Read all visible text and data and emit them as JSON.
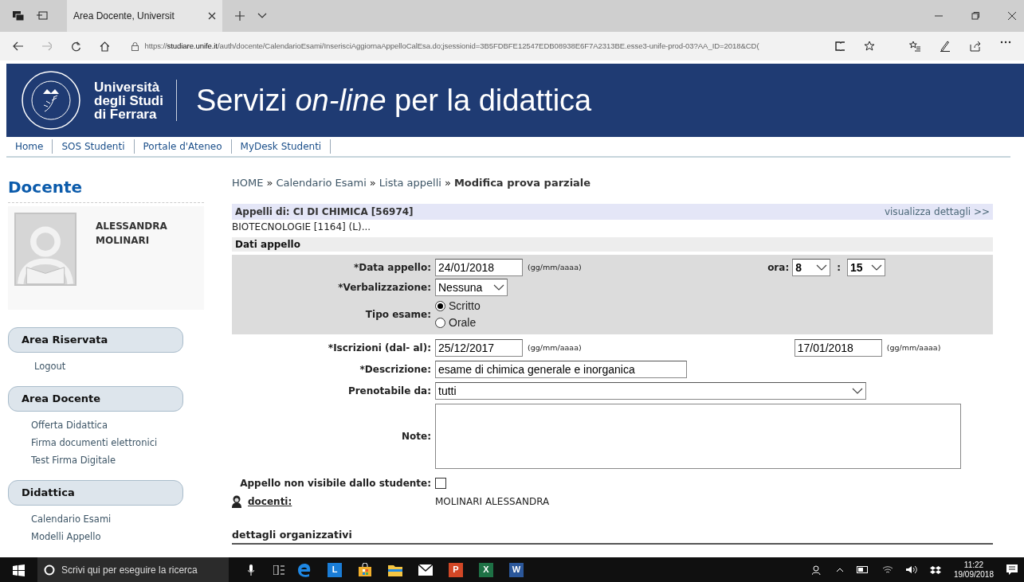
{
  "browser": {
    "tab_title": "Area Docente, Universit",
    "url": "https://**studiare.unife.it**/auth/docente/CalendarioEsami/InserisciAggiornaAppelloCalEsa.do;jsessionid=3B5FDBFE12547EDB08938E6F7A2313BE.esse3-unife-prod-03?AA_ID=2018&CD("
  },
  "header": {
    "logo_lines": [
      "Università",
      "degli Studi",
      "di Ferrara"
    ],
    "title": "Servizi *on-line* per la didattica"
  },
  "nav": [
    "Home",
    "SOS Studenti",
    "Portale d'Ateneo",
    "MyDesk Studenti"
  ],
  "sidebar": {
    "heading": "Docente",
    "user_name": "ALESSANDRA MOLINARI",
    "sections": [
      {
        "title": "Area Riservata",
        "links": [
          "Logout"
        ]
      },
      {
        "title": "Area Docente",
        "links": [
          "Offerta Didattica",
          "Firma documenti elettronici",
          "Test Firma Digitale"
        ]
      },
      {
        "title": "Didattica",
        "links": [
          "Calendario Esami",
          "Modelli Appello"
        ]
      }
    ]
  },
  "breadcrumb": [
    {
      "label": "HOME",
      "current": false
    },
    {
      "separator": "»",
      "label": "Calendario Esami",
      "current": false
    },
    {
      "separator": "»",
      "label": "Lista appelli",
      "current": false
    },
    {
      "separator": "»",
      "label": "Modifica prova parziale",
      "current": true
    }
  ],
  "appelli": {
    "title": "Appelli di: CI DI CHIMICA [56974]",
    "details_link": "visualizza dettagli >>",
    "subtitle": "BIOTECNOLOGIE [1164] (L)..."
  },
  "section_title": "Dati appello",
  "form": {
    "data_appello": {
      "label": "*Data appello:",
      "value": "24/01/2018",
      "hint": "(gg/mm/aaaa)"
    },
    "ora": {
      "label": "ora:",
      "hour": "8",
      "separator": ":",
      "minute": "15"
    },
    "verbalizzazione": {
      "label": "*Verbalizzazione:",
      "value": "Nessuna"
    },
    "tipo_esame": {
      "label": "Tipo esame:",
      "options": [
        {
          "label": "Scritto",
          "selected": true
        },
        {
          "label": "Orale",
          "selected": false
        }
      ]
    },
    "iscrizioni": {
      "label": "*Iscrizioni (dal- al):",
      "from": "25/12/2017",
      "from_hint": "(gg/mm/aaaa)",
      "to": "17/01/2018",
      "to_hint": "(gg/mm/aaaa)"
    },
    "descrizione": {
      "label": "*Descrizione:",
      "value": "esame di chimica generale e inorganica"
    },
    "prenotabile": {
      "label": "Prenotabile da:",
      "value": "tutti"
    },
    "note": {
      "label": "Note:"
    },
    "non_visibile": {
      "label": "Appello non visibile dallo studente:",
      "checked": false
    },
    "docenti": {
      "label": "docenti:",
      "value": "MOLINARI ALESSANDRA"
    }
  },
  "section2_title": "dettagli organizzativi",
  "taskbar": {
    "search_placeholder": "Scrivi qui per eseguire la ricerca",
    "apps": [
      {
        "kind": "edge",
        "color": "#1e88e5"
      },
      {
        "kind": "letter",
        "label": "L",
        "color": "#1a7dd7"
      },
      {
        "kind": "store",
        "color": "#f3b02c"
      },
      {
        "kind": "folder",
        "color": "#f5c542"
      },
      {
        "kind": "mail",
        "color": "#ffffff"
      },
      {
        "kind": "letter",
        "label": "P",
        "color": "#d24726"
      },
      {
        "kind": "letter",
        "label": "X",
        "color": "#1e7145"
      },
      {
        "kind": "letter",
        "label": "W",
        "color": "#2b579a"
      }
    ],
    "time": "11:22",
    "date": "19/09/2018"
  }
}
